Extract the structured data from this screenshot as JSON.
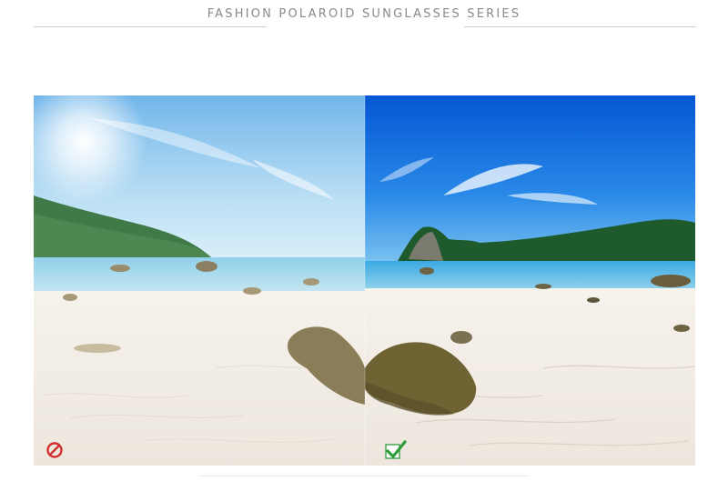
{
  "header": {
    "title": "FASHION POLAROID SUNGLASSES SERIES"
  },
  "comparison": {
    "left_panel": {
      "label": "without-polarized",
      "status_icon": "prohibited-icon",
      "status_color": "#d32f2f"
    },
    "right_panel": {
      "label": "with-polarized",
      "status_icon": "checkmark-icon",
      "status_color": "#2e9c3a"
    }
  },
  "colors": {
    "sky_left": "#9fd2f0",
    "sky_right": "#0c66d8",
    "sea_left": "#9fd8ea",
    "sea_right": "#4fb7e6",
    "sand": "#f3efe9",
    "rock": "#7d7350",
    "hill": "#2f6a3a"
  }
}
